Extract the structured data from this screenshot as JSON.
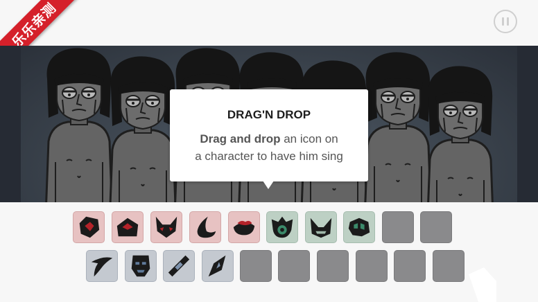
{
  "corner_badge": {
    "text": "乐乐亲测",
    "color": "#d5202a"
  },
  "pause_button": {
    "icon": "pause-icon"
  },
  "tooltip": {
    "title": "DRAG'N DROP",
    "body_bold": "Drag and drop",
    "body_line1_rest": " an icon on",
    "body_line2": "a character to have him sing"
  },
  "stage": {
    "characters": 7,
    "character_state": "idle-grey"
  },
  "tray": {
    "row1": [
      {
        "kind": "beat",
        "icon": "crystal-icon"
      },
      {
        "kind": "beat",
        "icon": "house-icon"
      },
      {
        "kind": "beat",
        "icon": "horned-mask-icon"
      },
      {
        "kind": "beat",
        "icon": "flame-icon"
      },
      {
        "kind": "beat",
        "icon": "lips-icon"
      },
      {
        "kind": "effect",
        "icon": "eye-icon"
      },
      {
        "kind": "effect",
        "icon": "helmet-icon"
      },
      {
        "kind": "effect",
        "icon": "gauntlet-icon"
      },
      {
        "kind": "empty",
        "icon": ""
      },
      {
        "kind": "empty",
        "icon": ""
      }
    ],
    "row2": [
      {
        "kind": "melody",
        "icon": "blade-icon"
      },
      {
        "kind": "melody",
        "icon": "face-mask-icon"
      },
      {
        "kind": "melody",
        "icon": "stick-icon"
      },
      {
        "kind": "melody",
        "icon": "diamond-icon"
      },
      {
        "kind": "empty",
        "icon": ""
      },
      {
        "kind": "empty",
        "icon": ""
      },
      {
        "kind": "empty",
        "icon": ""
      },
      {
        "kind": "empty",
        "icon": ""
      },
      {
        "kind": "empty",
        "icon": ""
      },
      {
        "kind": "empty",
        "icon": ""
      }
    ]
  }
}
